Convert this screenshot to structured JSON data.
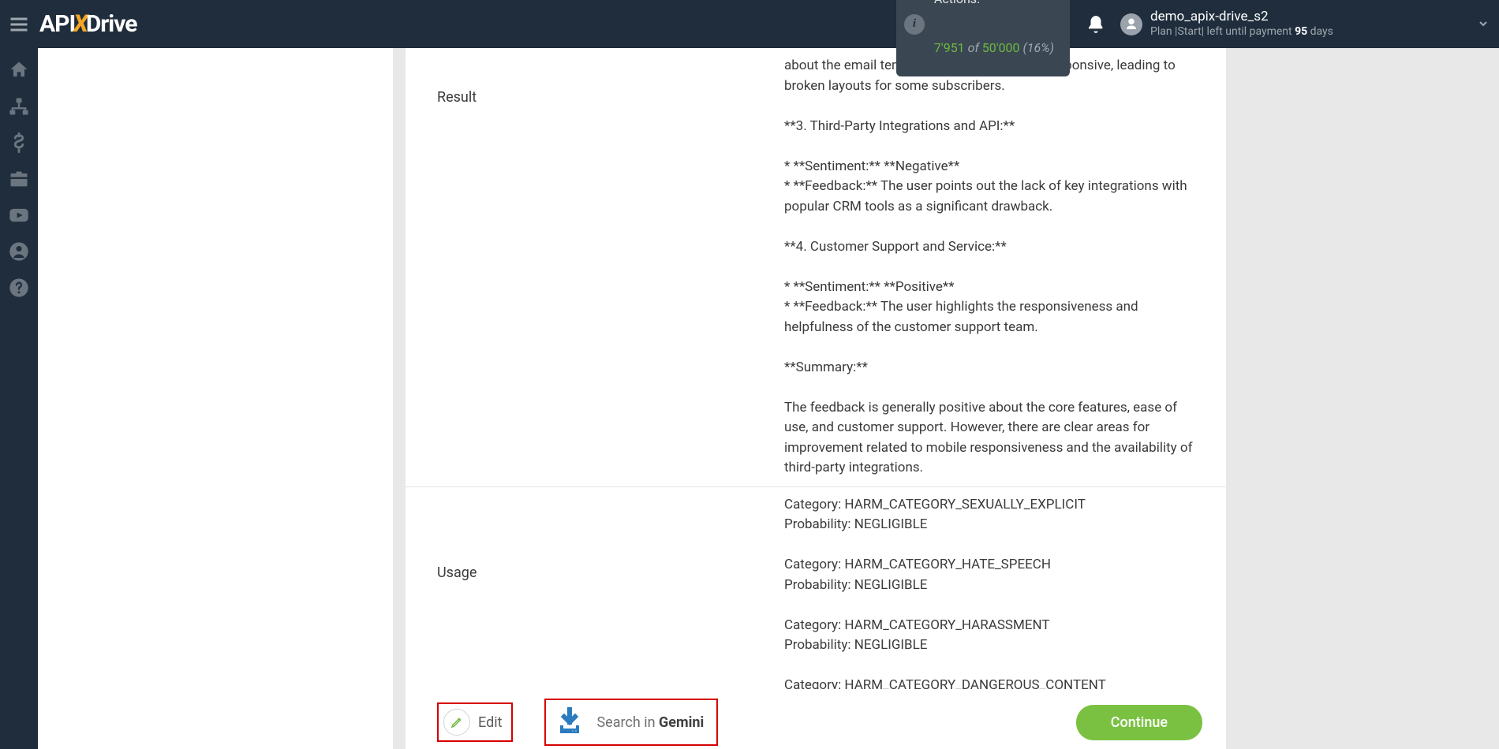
{
  "header": {
    "logo_pre": "API",
    "logo_mid": "X",
    "logo_post": "Drive",
    "actions_label": "Actions:",
    "actions_used": "7'951",
    "actions_of": " of ",
    "actions_limit": "50'000",
    "actions_percent": " (16%)",
    "user_name": "demo_apix-drive_s2",
    "plan_prefix": "Plan |Start| left until payment ",
    "plan_days": "95",
    "plan_suffix": " days"
  },
  "rows": {
    "result_label": "Result",
    "result_value": "about the email templates not being mobile responsive, leading to broken layouts for some subscribers.\n\n**3. Third-Party Integrations and API:**\n\n* **Sentiment:** **Negative**\n* **Feedback:** The user points out the lack of key integrations with popular CRM tools as a significant drawback.\n\n**4. Customer Support and Service:**\n\n* **Sentiment:** **Positive**\n* **Feedback:** The user highlights the responsiveness and helpfulness of the customer support team.\n\n**Summary:**\n\nThe feedback is generally positive about the core features, ease of use, and customer support. However, there are clear areas for improvement related to mobile responsiveness and the availability of third-party integrations.",
    "usage_label": "Usage",
    "usage_value": "Category: HARM_CATEGORY_SEXUALLY_EXPLICIT\nProbability: NEGLIGIBLE\n\nCategory: HARM_CATEGORY_HATE_SPEECH\nProbability: NEGLIGIBLE\n\nCategory: HARM_CATEGORY_HARASSMENT\nProbability: NEGLIGIBLE\n\nCategory: HARM_CATEGORY_DANGEROUS_CONTENT\nProbability: NEGLIGIBLE"
  },
  "actions": {
    "edit": "Edit",
    "search_prefix": "Search in ",
    "search_bold": "Gemini",
    "continue": "Continue"
  }
}
